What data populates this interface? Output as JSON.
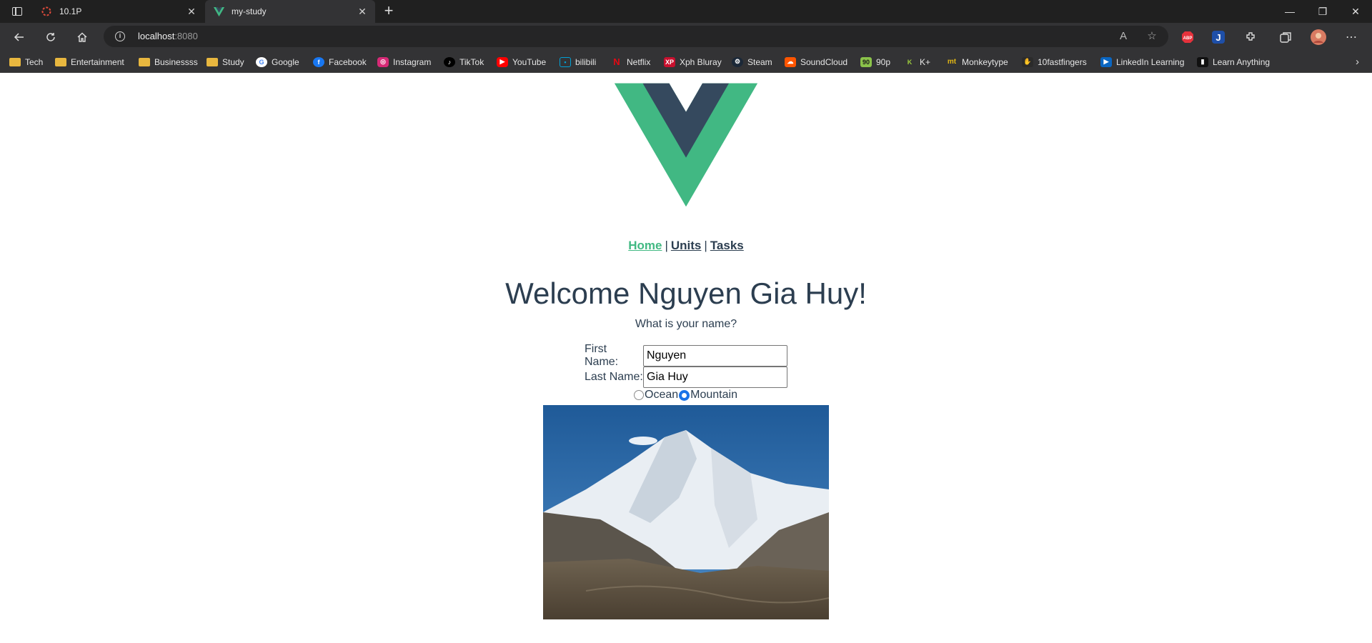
{
  "browser": {
    "tabs": [
      {
        "title": "10.1P",
        "active": false
      },
      {
        "title": "my-study",
        "active": true
      }
    ],
    "url_host": "localhost",
    "url_port": ":8080",
    "bookmarks": [
      {
        "label": "Tech",
        "icon": "folder-icon"
      },
      {
        "label": "Entertainment",
        "icon": "folder-icon"
      },
      {
        "label": "Businessss",
        "icon": "folder-icon"
      },
      {
        "label": "Study",
        "icon": "folder-icon"
      },
      {
        "label": "Google",
        "icon": "google-icon"
      },
      {
        "label": "Facebook",
        "icon": "facebook-icon"
      },
      {
        "label": "Instagram",
        "icon": "instagram-icon"
      },
      {
        "label": "TikTok",
        "icon": "tiktok-icon"
      },
      {
        "label": "YouTube",
        "icon": "youtube-icon"
      },
      {
        "label": "bilibili",
        "icon": "bilibili-icon"
      },
      {
        "label": "Netflix",
        "icon": "netflix-icon"
      },
      {
        "label": "Xph Bluray",
        "icon": "xph-icon"
      },
      {
        "label": "Steam",
        "icon": "steam-icon"
      },
      {
        "label": "SoundCloud",
        "icon": "soundcloud-icon"
      },
      {
        "label": "90p",
        "icon": "90p-icon"
      },
      {
        "label": "K+",
        "icon": "kplus-icon"
      },
      {
        "label": "Monkeytype",
        "icon": "monkeytype-icon"
      },
      {
        "label": "10fastfingers",
        "icon": "10fastfingers-icon"
      },
      {
        "label": "LinkedIn Learning",
        "icon": "linkedin-learning-icon"
      },
      {
        "label": "Learn Anything",
        "icon": "learn-anything-icon"
      }
    ]
  },
  "page": {
    "nav": {
      "home": "Home",
      "units": "Units",
      "tasks": "Tasks",
      "separator": "|"
    },
    "welcome": "Welcome Nguyen Gia Huy!",
    "question": "What is your name?",
    "first_name_label": "First Name:",
    "first_name_value": "Nguyen",
    "last_name_label": "Last Name:",
    "last_name_value": "Gia Huy",
    "radio_ocean": "Ocean",
    "radio_mountain": "Mountain",
    "selected_radio": "Mountain"
  },
  "colors": {
    "vue_green": "#42b983",
    "vue_dark": "#35495e",
    "text": "#2c3e50",
    "radio_accent": "#1a73e8"
  }
}
